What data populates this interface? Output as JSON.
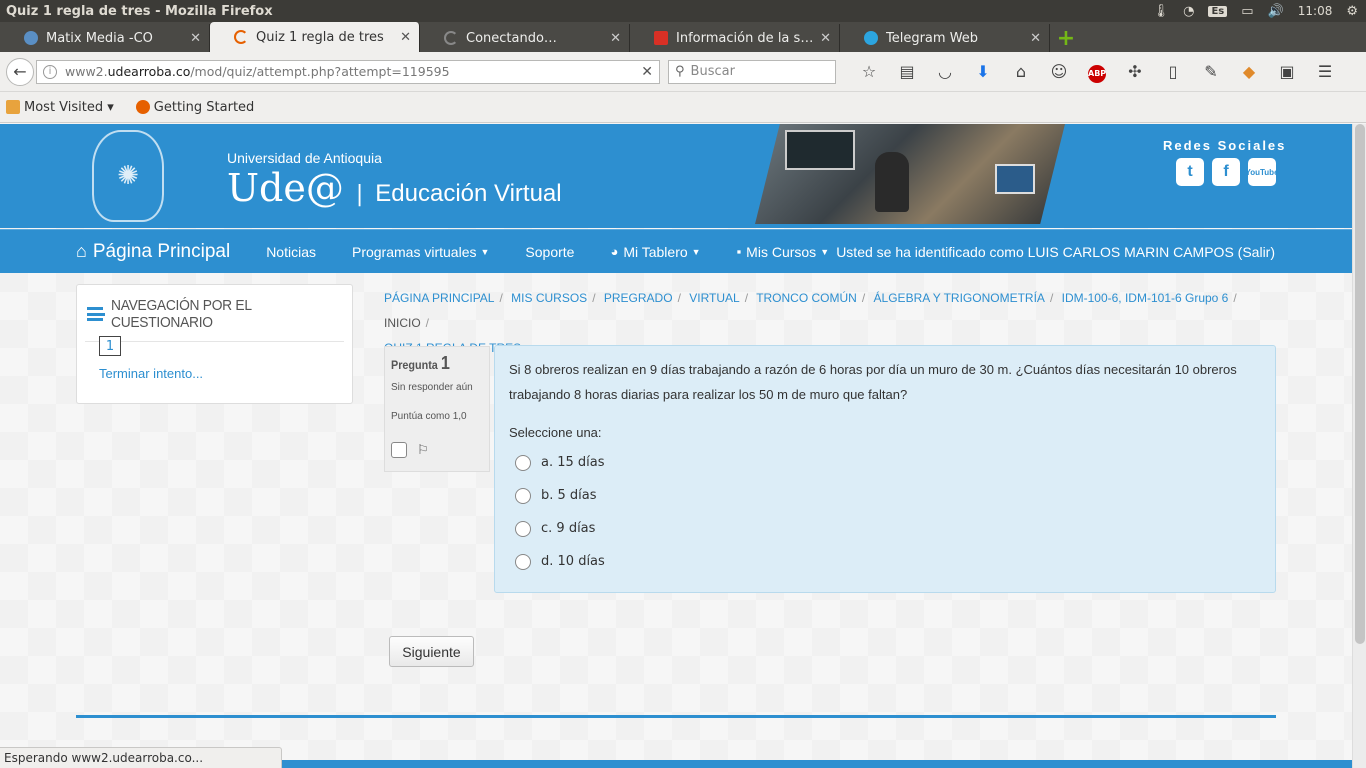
{
  "window": {
    "title": "Quiz 1 regla de tres - Mozilla Firefox",
    "clock": "11:08",
    "keyboard_layout": "Es"
  },
  "tabs": [
    {
      "label": "Matix Media -CO",
      "favicon_color": "#5a8fc4",
      "active": false
    },
    {
      "label": "Quiz 1 regla de tres",
      "favicon_color": "#e66000",
      "active": true
    },
    {
      "label": "Conectando…",
      "favicon_color": "#888888",
      "active": false
    },
    {
      "label": "Información de la sede …",
      "favicon_color": "#d93025",
      "active": false
    },
    {
      "label": "Telegram Web",
      "favicon_color": "#2ca5e0",
      "active": false
    }
  ],
  "navbar": {
    "url_prefix": "www2.",
    "url_domain": "udearroba.co",
    "url_path": "/mod/quiz/attempt.php?attempt=119595",
    "search_placeholder": "Buscar"
  },
  "bookmarks": [
    {
      "label": "Most Visited ▾",
      "icon": "folder-icon"
    },
    {
      "label": "Getting Started",
      "icon": "firefox-icon"
    }
  ],
  "header": {
    "university": "Universidad de Antioquia",
    "brand": "Ude@",
    "separator": "|",
    "subtitle": "Educación Virtual",
    "social_title": "Redes Sociales",
    "youtube_top": "You",
    "youtube_bottom": "Tube",
    "accent_color": "#2d8fd0"
  },
  "main_nav": {
    "home": "Página Principal",
    "items": [
      "Noticias",
      "Programas virtuales",
      "Soporte",
      "Mi Tablero",
      "Mis Cursos"
    ],
    "user_text": "Usted se ha identificado como LUIS CARLOS MARIN CAMPOS (Salir)"
  },
  "quiz_nav": {
    "title": "Navegación por el cuestionario",
    "question_button": "1",
    "finish_link": "Terminar intento..."
  },
  "breadcrumb": [
    "Página Principal",
    "Mis cursos",
    "Pregrado",
    "Virtual",
    "Tronco común",
    "Álgebra y trigonometría",
    "IDM-100-6, IDM-101-6 Grupo 6",
    "Inicio",
    "Quiz 1 regla de tres"
  ],
  "question": {
    "label": "Pregunta",
    "number": "1",
    "state": "Sin responder aún",
    "grade": "Puntúa como 1,0",
    "text": "Si 8 obreros realizan en 9 días trabajando a razón de 6 horas por día un muro de 30 m. ¿Cuántos días necesitarán 10 obreros trabajando 8 horas diarias para realizar los 50 m de muro que faltan?",
    "prompt": "Seleccione una:",
    "answers": [
      "a. 15 días",
      "b. 5 días",
      "c. 9 días",
      "d. 10 días"
    ]
  },
  "submit": {
    "next": "Siguiente"
  },
  "status_bar": "Esperando www2.udearroba.co..."
}
